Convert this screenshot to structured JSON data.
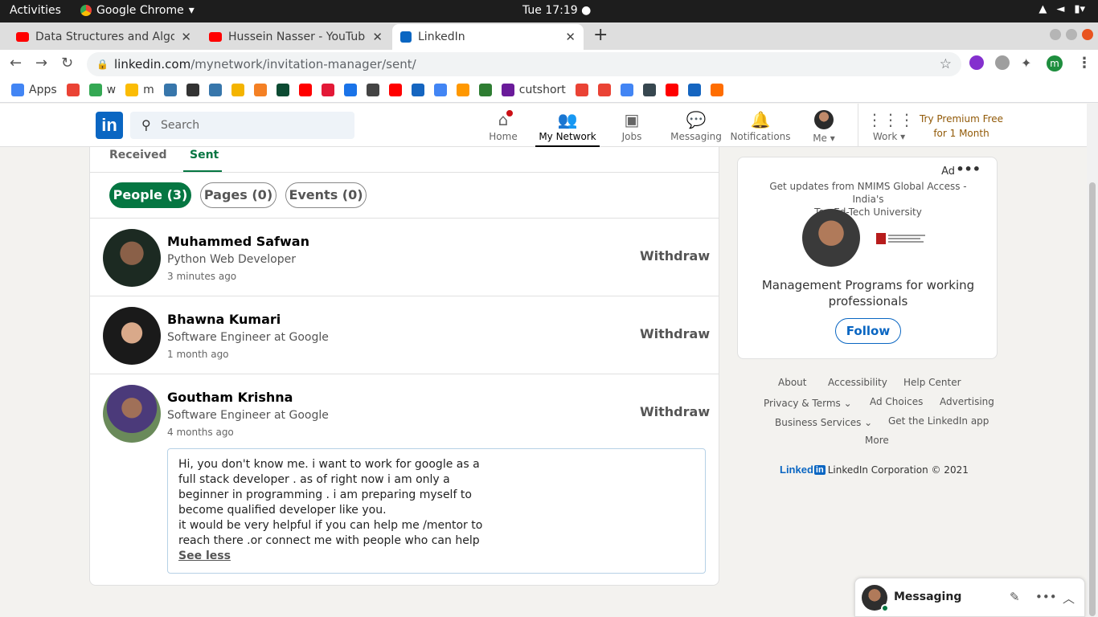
{
  "os_bar": {
    "activities": "Activities",
    "app_name": "Google Chrome",
    "clock": "Tue 17:19"
  },
  "tabs": [
    {
      "title": "Data Structures and Algo",
      "color": "#ff0000"
    },
    {
      "title": "Hussein Nasser - YouTube",
      "color": "#ff0000"
    },
    {
      "title": "LinkedIn",
      "color": "#0a66c2"
    }
  ],
  "browser": {
    "url_host": "linkedin.com",
    "url_path": "/mynetwork/invitation-manager/sent/",
    "profile_initial": "m"
  },
  "bookmarks": [
    {
      "label": "Apps",
      "color": "#4285f4"
    },
    {
      "label": "",
      "color": "#ea4335"
    },
    {
      "label": "w",
      "color": "#34a853"
    },
    {
      "label": "m",
      "color": "#fbbc05"
    },
    {
      "label": "",
      "color": "#3776ab"
    },
    {
      "label": "",
      "color": "#333333"
    },
    {
      "label": "",
      "color": "#3776ab"
    },
    {
      "label": "",
      "color": "#f4b400"
    },
    {
      "label": "",
      "color": "#f48024"
    },
    {
      "label": "",
      "color": "#0c4b33"
    },
    {
      "label": "",
      "color": "#ff0000"
    },
    {
      "label": "",
      "color": "#e31937"
    },
    {
      "label": "",
      "color": "#1a73e8"
    },
    {
      "label": "",
      "color": "#444444"
    },
    {
      "label": "",
      "color": "#ff0000"
    },
    {
      "label": "",
      "color": "#1565c0"
    },
    {
      "label": "",
      "color": "#4285f4"
    },
    {
      "label": "",
      "color": "#ff9800"
    },
    {
      "label": "",
      "color": "#2e7d32"
    },
    {
      "label": "cutshort",
      "color": "#6a1b9a"
    },
    {
      "label": "",
      "color": "#ea4335"
    },
    {
      "label": "",
      "color": "#ea4335"
    },
    {
      "label": "",
      "color": "#4285f4"
    },
    {
      "label": "",
      "color": "#37474f"
    },
    {
      "label": "",
      "color": "#ff0000"
    },
    {
      "label": "",
      "color": "#1565c0"
    },
    {
      "label": "",
      "color": "#ff6d00"
    }
  ],
  "linkedin_nav": {
    "search_placeholder": "Search",
    "items": [
      {
        "label": "Home"
      },
      {
        "label": "My Network"
      },
      {
        "label": "Jobs"
      },
      {
        "label": "Messaging"
      },
      {
        "label": "Notifications"
      },
      {
        "label": "Me"
      },
      {
        "label": "Work"
      }
    ],
    "premium_line1": "Try Premium Free",
    "premium_line2": "for 1 Month"
  },
  "invitations": {
    "tab_received": "Received",
    "tab_sent": "Sent",
    "filters": [
      "People (3)",
      "Pages (0)",
      "Events (0)"
    ],
    "people": [
      {
        "name": "Muhammed Safwan",
        "title": "Python Web Developer",
        "time": "3 minutes ago",
        "action": "Withdraw"
      },
      {
        "name": "Bhawna Kumari",
        "title": "Software Engineer at Google",
        "time": "1 month ago",
        "action": "Withdraw"
      },
      {
        "name": "Goutham Krishna",
        "title": "Software Engineer at Google",
        "time": "4 months ago",
        "action": "Withdraw"
      }
    ],
    "message_lines": [
      "Hi, you don't know me. i want to work for google as a",
      "full stack developer . as of right now i am only a",
      "beginner in programming . i am preparing myself to",
      "become qualified developer like you.",
      "it would be very helpful if you can help me /mentor to",
      "reach there .or connect me with people who can help"
    ],
    "see_less": "See less"
  },
  "ad": {
    "label": "Ad",
    "more": "•••",
    "headline_line1": "Get updates from NMIMS Global Access - India's",
    "headline_line2": "Top Ed-Tech University",
    "title_line1": "Management Programs for working",
    "title_line2": "professionals",
    "follow": "Follow"
  },
  "footer": {
    "about": "About",
    "accessibility": "Accessibility",
    "help": "Help Center",
    "privacy": "Privacy & Terms",
    "ad_choices": "Ad Choices",
    "advertising": "Advertising",
    "business": "Business Services",
    "get_app": "Get the LinkedIn app",
    "more": "More",
    "brand_word": "Linked",
    "brand_in": "in",
    "copyright": "LinkedIn Corporation © 2021"
  },
  "messaging": {
    "label": "Messaging"
  }
}
